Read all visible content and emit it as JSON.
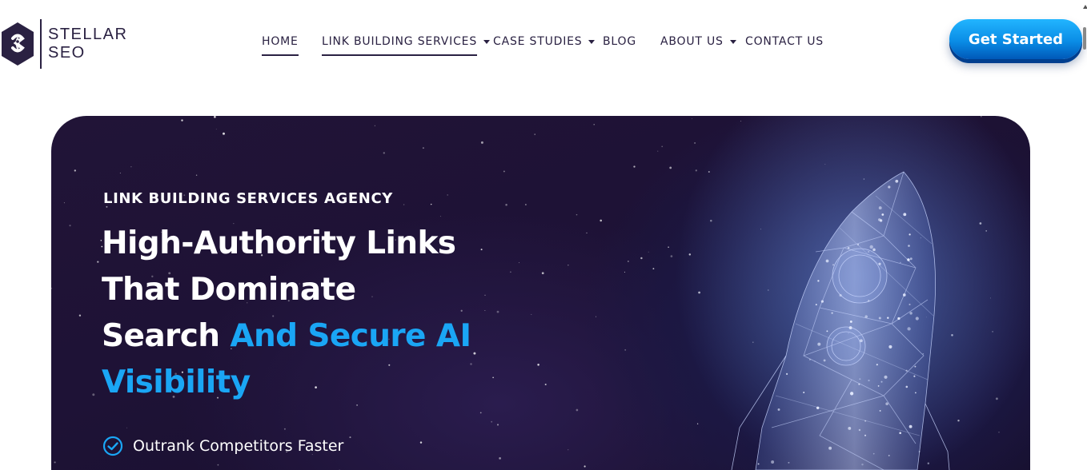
{
  "brand": {
    "line1": "STELLAR",
    "line2": "SEO",
    "color": "#2a2142"
  },
  "nav": {
    "items": [
      {
        "label": "HOME",
        "dropdown": false,
        "underlined": true
      },
      {
        "label": "LINK BUILDING SERVICES",
        "dropdown": true,
        "underlined": true
      },
      {
        "label": "CASE STUDIES",
        "dropdown": true,
        "underlined": false
      },
      {
        "label": "BLOG",
        "dropdown": false,
        "underlined": false
      },
      {
        "label": "ABOUT US",
        "dropdown": true,
        "underlined": false
      },
      {
        "label": "CONTACT US",
        "dropdown": false,
        "underlined": false
      }
    ],
    "chevron_icon": "chevron-down-icon"
  },
  "cta": {
    "label": "Get Started",
    "color": "#1aa6f5"
  },
  "hero": {
    "eyebrow": "LINK BUILDING SERVICES AGENCY",
    "title_line1": "High-Authority Links",
    "title_line2": "That Dominate",
    "title_line3_plain": "Search ",
    "title_line3_accent": "And Secure AI",
    "title_line4_accent": "Visibility",
    "accent_color": "#1aa6f5",
    "background_color": "#1e1236",
    "image": "rocket-illustration",
    "bullets": [
      {
        "icon": "check-circle-icon",
        "text": "Outrank Competitors Faster"
      }
    ]
  }
}
